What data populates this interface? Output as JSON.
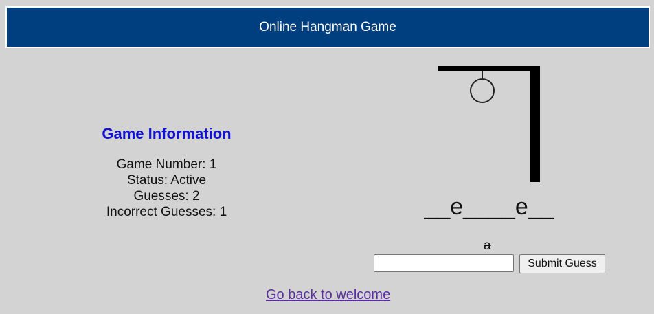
{
  "header": {
    "title": "Online Hangman Game",
    "background_color": "#003f7f"
  },
  "info": {
    "title": "Game Information",
    "title_color": "#1212d4",
    "game_number": "Game Number: 1",
    "status": "Status: Active",
    "guesses": "Guesses: 2",
    "incorrect_guesses": "Incorrect Guesses: 1"
  },
  "game": {
    "word_display": "__e____e__",
    "incorrect_letters": "a",
    "gallows_icon": "hangman-gallows-with-head"
  },
  "form": {
    "guess_value": "",
    "submit_label": "Submit Guess"
  },
  "nav": {
    "back_link_label": "Go back to welcome",
    "link_color": "#5a2ea0"
  }
}
